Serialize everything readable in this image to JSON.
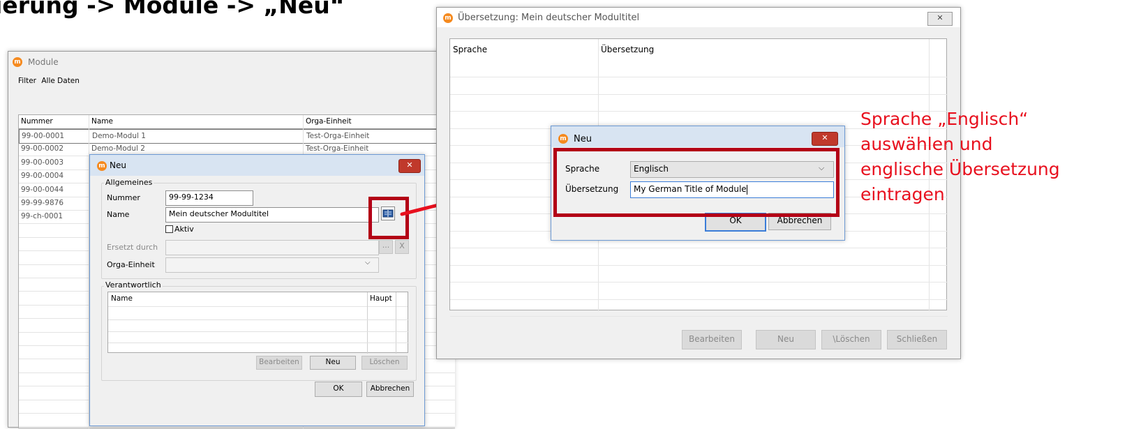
{
  "heading": "ierung -> Module -> „Neu“",
  "module_window": {
    "title": "Module",
    "menu": [
      "Filter",
      "Alle Daten"
    ],
    "columns": [
      "Nummer",
      "Name",
      "Orga-Einheit"
    ],
    "rows": [
      {
        "nummer": "99-00-0001",
        "name": "Demo-Modul 1",
        "orga": "Test-Orga-Einheit"
      },
      {
        "nummer": "99-00-0002",
        "name": "Demo-Modul 2",
        "orga": "Test-Orga-Einheit"
      },
      {
        "nummer": "99-00-0003",
        "name": "",
        "orga": ""
      },
      {
        "nummer": "99-00-0004",
        "name": "",
        "orga": ""
      },
      {
        "nummer": "99-00-0044",
        "name": "",
        "orga": ""
      },
      {
        "nummer": "99-99-9876",
        "name": "",
        "orga": ""
      },
      {
        "nummer": "99-ch-0001",
        "name": "",
        "orga": ""
      }
    ]
  },
  "neu_dialog": {
    "title": "Neu",
    "close_label": "✕",
    "group_general": "Allgemeines",
    "nummer_label": "Nummer",
    "nummer_value": "99-99-1234",
    "name_label": "Name",
    "name_value": "Mein deutscher Modultitel",
    "aktiv_label": "Aktiv",
    "ersetzt_label": "Ersetzt durch",
    "ersetzt_dots": "...",
    "ersetzt_clear": "X",
    "orga_label": "Orga-Einheit",
    "group_responsible": "Verantwortlich",
    "resp_columns": [
      "Name",
      "Haupt"
    ],
    "btn_bearbeiten": "Bearbeiten",
    "btn_neu": "Neu",
    "btn_loeschen": "Löschen",
    "btn_ok": "OK",
    "btn_abbrechen": "Abbrechen"
  },
  "translation_window": {
    "title": "Übersetzung: Mein deutscher Modultitel",
    "close_label": "✕",
    "columns": [
      "Sprache",
      "Übersetzung"
    ],
    "btn_bearbeiten": "Bearbeiten",
    "btn_neu": "Neu",
    "btn_loeschen": "\\Löschen",
    "btn_schliessen": "Schließen"
  },
  "new_translation_dialog": {
    "title": "Neu",
    "close_label": "✕",
    "sprache_label": "Sprache",
    "sprache_value": "Englisch",
    "uebersetzung_label": "Übersetzung",
    "uebersetzung_value": "My German Title of Module",
    "btn_ok": "OK",
    "btn_abbrechen": "Abbrechen"
  },
  "annotation": {
    "lines": [
      "Sprache „Englisch“",
      "auswählen und",
      "englische Übersetzung",
      "eintragen"
    ],
    "color": "#e8101e"
  },
  "colors": {
    "highlight_box": "#b30016",
    "arrow": "#e8101e",
    "logo": "#f58a1f"
  }
}
